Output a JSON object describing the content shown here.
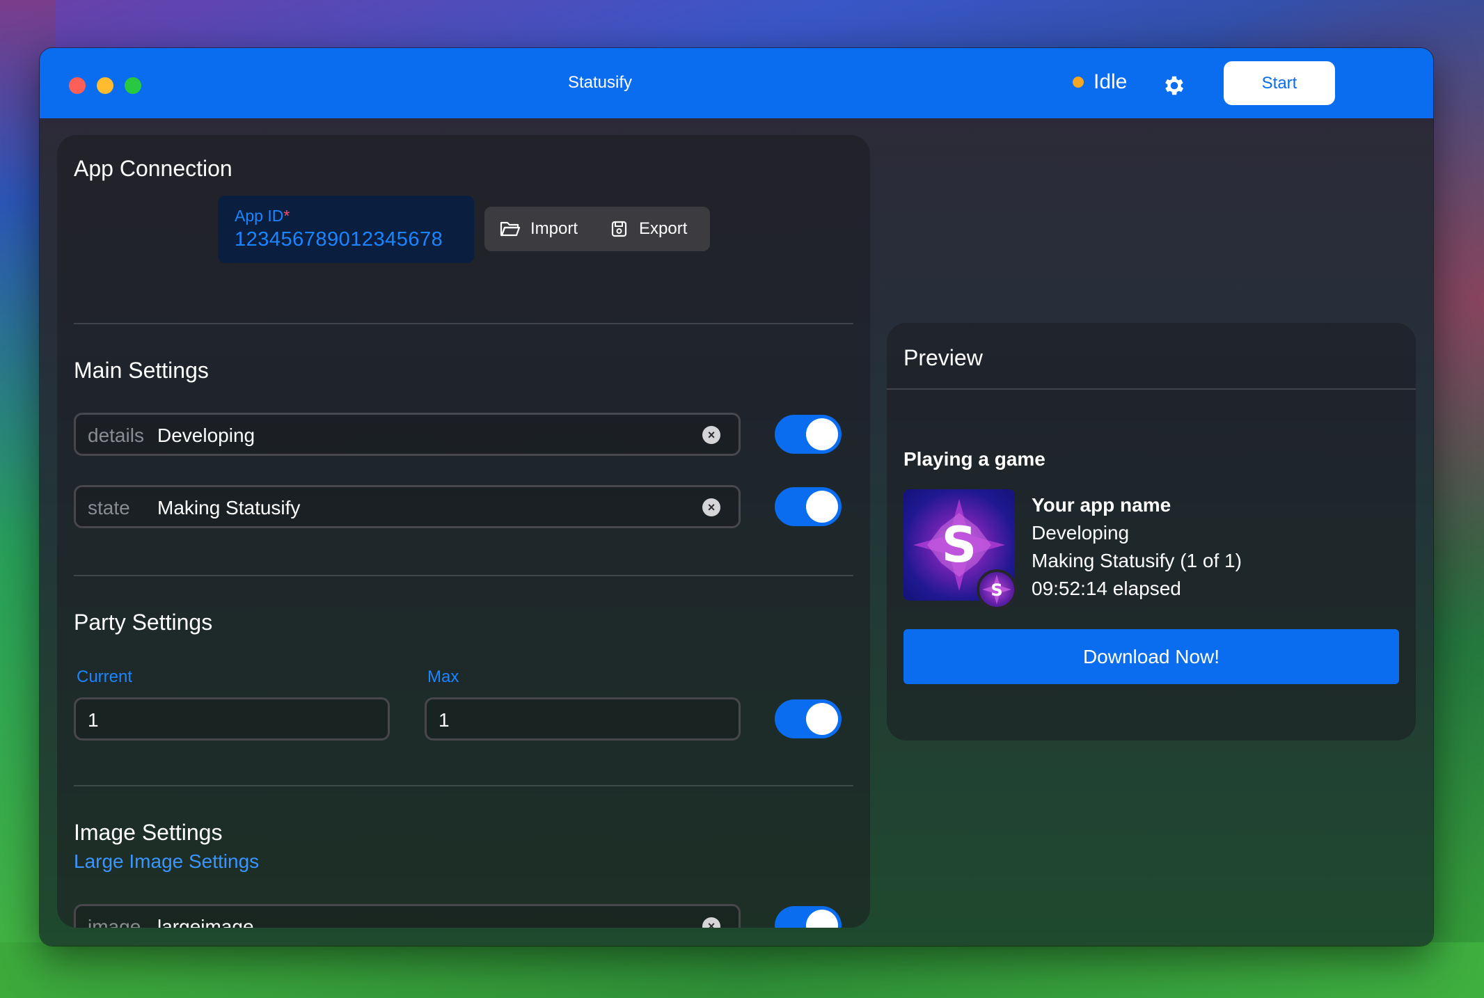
{
  "window": {
    "title": "Statusify"
  },
  "header": {
    "status_text": "Idle",
    "status_color": "#f5a623",
    "settings_icon": "gear-icon",
    "start_label": "Start"
  },
  "app_connection": {
    "title": "App Connection",
    "app_id_label": "App ID",
    "app_id_required_mark": "*",
    "app_id_value": "123456789012345678",
    "import_label": "Import",
    "import_icon": "folder-open-icon",
    "export_label": "Export",
    "export_icon": "save-disk-icon"
  },
  "main_settings": {
    "title": "Main Settings",
    "fields": [
      {
        "key": "details",
        "value": "Developing",
        "enabled": true
      },
      {
        "key": "state",
        "value": "Making Statusify",
        "enabled": true
      }
    ]
  },
  "party_settings": {
    "title": "Party Settings",
    "current_label": "Current",
    "current_value": "1",
    "max_label": "Max",
    "max_value": "1",
    "enabled": true
  },
  "image_settings": {
    "title": "Image Settings",
    "large_image_link": "Large Image Settings",
    "fields": [
      {
        "key": "image",
        "value": "largeimage",
        "enabled": true
      }
    ]
  },
  "preview": {
    "title": "Preview",
    "activity_heading": "Playing a game",
    "app_name": "Your app name",
    "details": "Developing",
    "state": "Making Statusify (1 of 1)",
    "elapsed": "09:52:14 elapsed",
    "large_image_letter": "S",
    "small_image_letter": "S",
    "button_label": "Download Now!"
  },
  "colors": {
    "accent": "#0a6df0",
    "link": "#1b85ff"
  }
}
